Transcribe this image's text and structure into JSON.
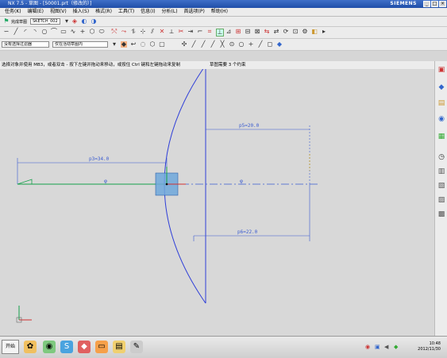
{
  "window": {
    "title": "NX 7.5 - 草图 - [50001.prt（修改的）]",
    "brand": "SIEMENS",
    "controls": [
      "_",
      "□",
      "×"
    ]
  },
  "menu": [
    "任务(K)",
    "编辑(E)",
    "视图(V)",
    "插入(S)",
    "格式(R)",
    "工具(T)",
    "信息(I)",
    "分析(L)",
    "首选项(P)",
    "帮助(H)"
  ],
  "toolbar2": {
    "finish_label": "完成草图",
    "sketch_name": "SKETCH_002"
  },
  "toolbar4": {
    "filter_label": "没有选择过滤器",
    "scope_label": "仅在活动草图内"
  },
  "cue_line": {
    "prompt": "选择对象并使用 MB3，或者双击 - 按下左键并拖动来移动，或按住 Ctrl 键和左键拖动来复制",
    "status": "草图需要 3 个约束"
  },
  "dimensions": {
    "p3": "p3=34.0",
    "p5": "p5=20.0",
    "p6": "p6=22.0",
    "phi_left": "φ",
    "phi_right": "φ"
  },
  "resource_bar_icons": [
    "assembly-navigator-icon",
    "constraint-navigator-icon",
    "part-navigator-icon",
    "reuse-library-icon",
    "web-browser-icon",
    "history-icon",
    "system-materials-icon",
    "process-studio-icon",
    "roles-icon",
    "palette-icon"
  ],
  "taskbar": {
    "start_label": "开始",
    "clock_time": "10:48",
    "clock_date": "2012/11/30"
  },
  "colors": {
    "sketch_curve": "#2f3fd8",
    "dimension": "#3a5bd0",
    "centerline": "#3a5bd0",
    "axis_green": "#14a04a",
    "highlight_fill": "#6fa8dc"
  }
}
